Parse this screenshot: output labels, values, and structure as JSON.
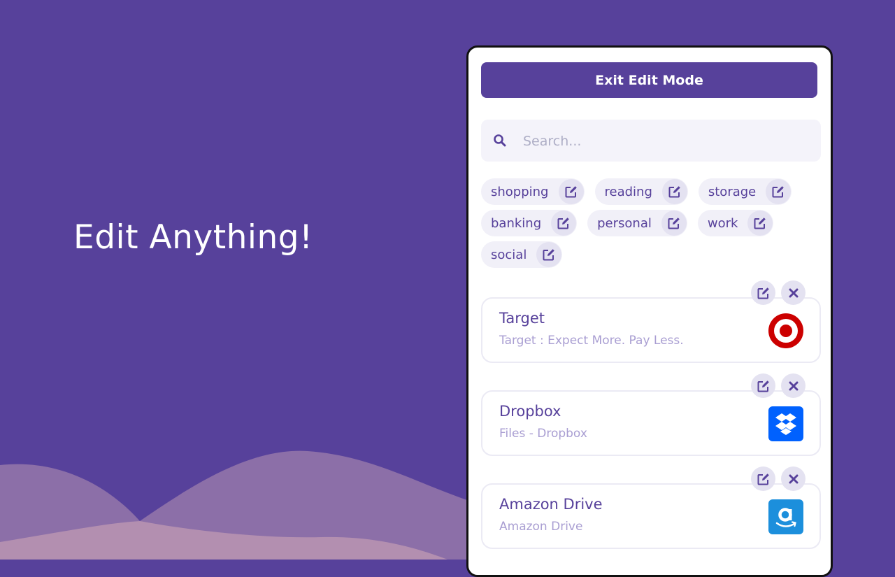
{
  "headline": "Edit Anything!",
  "colors": {
    "brand": "#57419b",
    "tag_bg": "#f1f0f8",
    "icon_bg": "#e4e2f1",
    "subtitle": "#a99ed2"
  },
  "toolbar": {
    "exit_label": "Exit Edit Mode"
  },
  "search": {
    "placeholder": "Search...",
    "value": "",
    "icon": "search-icon"
  },
  "tags": [
    {
      "label": "shopping",
      "icon": "edit-icon"
    },
    {
      "label": "reading",
      "icon": "edit-icon"
    },
    {
      "label": "storage",
      "icon": "edit-icon"
    },
    {
      "label": "banking",
      "icon": "edit-icon"
    },
    {
      "label": "personal",
      "icon": "edit-icon"
    },
    {
      "label": "work",
      "icon": "edit-icon"
    },
    {
      "label": "social",
      "icon": "edit-icon"
    }
  ],
  "bookmarks": [
    {
      "title": "Target",
      "subtitle": "Target : Expect More. Pay Less.",
      "logo": "target-logo"
    },
    {
      "title": "Dropbox",
      "subtitle": "Files - Dropbox",
      "logo": "dropbox-logo"
    },
    {
      "title": "Amazon Drive",
      "subtitle": "Amazon Drive",
      "logo": "amazon-logo"
    }
  ]
}
